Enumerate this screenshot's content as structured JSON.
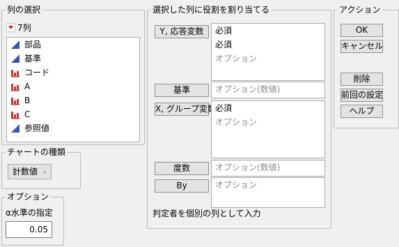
{
  "column_select": {
    "title": "列の選択",
    "count_label": "7列",
    "columns": [
      {
        "name": "部品",
        "type": "continuous"
      },
      {
        "name": "基準",
        "type": "continuous"
      },
      {
        "name": "コード",
        "type": "nominal"
      },
      {
        "name": "A",
        "type": "nominal"
      },
      {
        "name": "B",
        "type": "nominal"
      },
      {
        "name": "C",
        "type": "nominal"
      },
      {
        "name": "参照値",
        "type": "continuous"
      }
    ]
  },
  "roles": {
    "title": "選択した列に役割を割り当てる",
    "y_button": "Y, 応答変数",
    "y_lines": [
      "必須",
      "必須",
      "オプション"
    ],
    "standard_button": "基準",
    "standard_placeholder": "オプション(数値)",
    "x_button": "X, グループ変数",
    "x_lines": [
      "必須",
      "オプション"
    ],
    "freq_button": "度数",
    "freq_placeholder": "オプション(数値)",
    "by_button": "By",
    "by_placeholder": "オプション",
    "footer": "判定者を個別の列として入力"
  },
  "actions": {
    "title": "アクション",
    "ok": "OK",
    "cancel": "キャンセル",
    "remove": "削除",
    "recall": "前回の設定",
    "help": "ヘルプ"
  },
  "chart_type": {
    "title": "チャートの種類",
    "selected": "計数値"
  },
  "options": {
    "title": "オプション",
    "alpha_label": "α水準の指定",
    "alpha_value": "0.05"
  },
  "colors": {
    "continuous_icon": "#3a55b4",
    "nominal_icon": "#c8372d",
    "count_triangle": "#d22020"
  }
}
